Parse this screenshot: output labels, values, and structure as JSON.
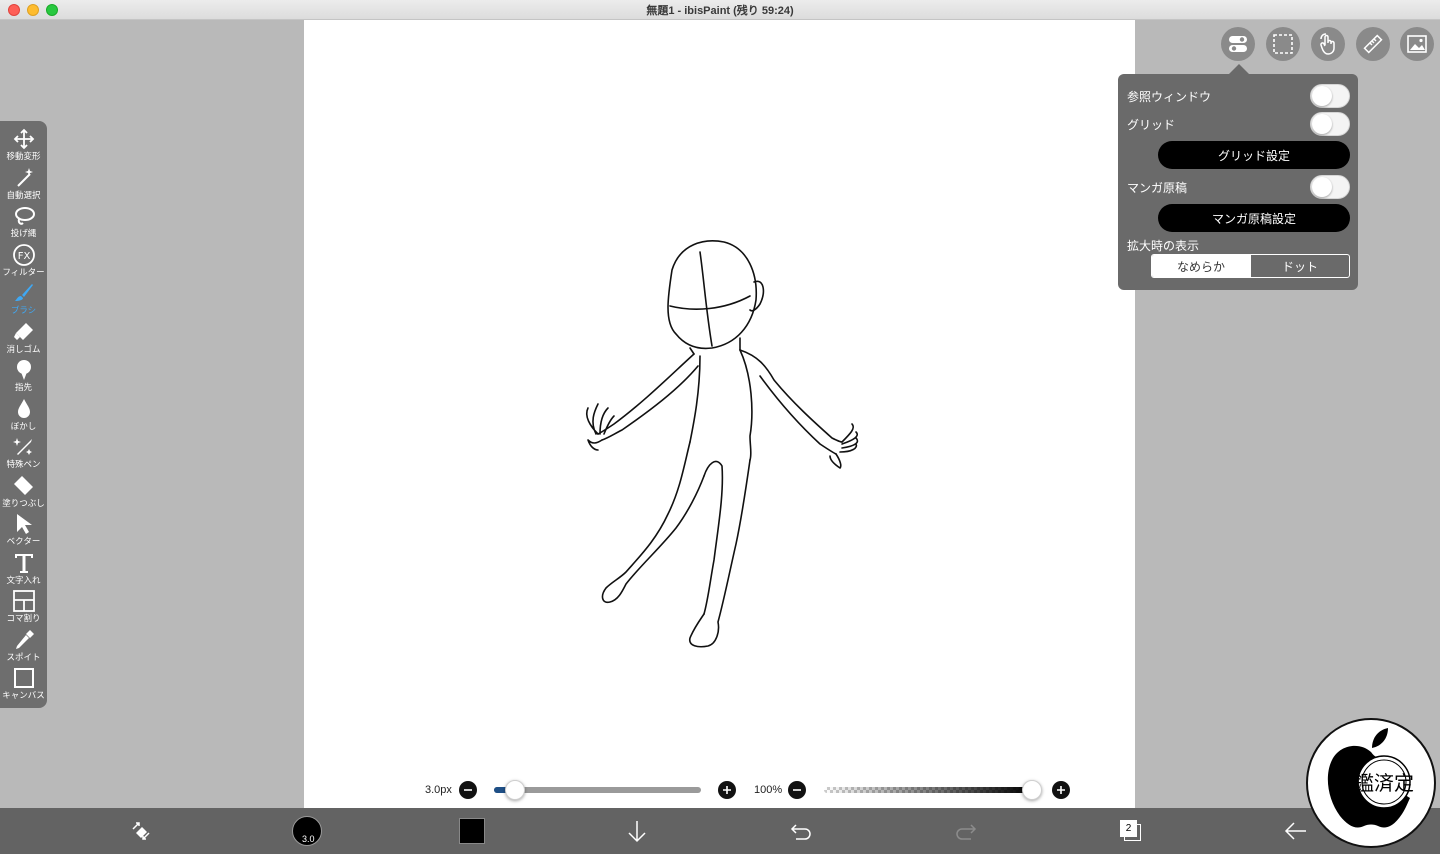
{
  "window": {
    "title": "無題1 - ibisPaint (残り 59:24)"
  },
  "toolbar": {
    "items": [
      {
        "label": "移動変形",
        "icon": "move-transform-icon"
      },
      {
        "label": "自動選択",
        "icon": "magic-wand-icon"
      },
      {
        "label": "投げ縄",
        "icon": "lasso-icon"
      },
      {
        "label": "フィルター",
        "icon": "fx-filter-icon"
      },
      {
        "label": "ブラシ",
        "icon": "brush-icon",
        "active": true
      },
      {
        "label": "消しゴム",
        "icon": "eraser-icon"
      },
      {
        "label": "指先",
        "icon": "finger-smudge-icon"
      },
      {
        "label": "ぼかし",
        "icon": "blur-drop-icon"
      },
      {
        "label": "特殊ペン",
        "icon": "special-pen-icon"
      },
      {
        "label": "塗りつぶし",
        "icon": "fill-bucket-icon"
      },
      {
        "label": "ベクター",
        "icon": "vector-arrow-icon"
      },
      {
        "label": "文字入れ",
        "icon": "text-tool-icon"
      },
      {
        "label": "コマ割り",
        "icon": "frame-divider-icon"
      },
      {
        "label": "スポイト",
        "icon": "eyedropper-icon"
      },
      {
        "label": "キャンバス",
        "icon": "canvas-icon"
      }
    ]
  },
  "popup": {
    "reference_window": "参照ウィンドウ",
    "grid": "グリッド",
    "grid_settings": "グリッド設定",
    "manga": "マンガ原稿",
    "manga_settings": "マンガ原稿設定",
    "zoom_display": "拡大時の表示",
    "smooth": "なめらか",
    "dot": "ドット"
  },
  "sliders": {
    "brush_size": "3.0px",
    "brush_size_fraction": 0.1,
    "opacity": "100%",
    "opacity_fraction": 1.0
  },
  "bottom": {
    "brush_size_badge": "3.0",
    "layer_count": "2",
    "current_color": "#000000"
  },
  "watermark": {
    "text": "鑑済定"
  },
  "colors": {
    "accent": "#3fa8f4",
    "toolbar_bg": "#6e6e6e",
    "popup_bg": "#6a6a6a"
  }
}
